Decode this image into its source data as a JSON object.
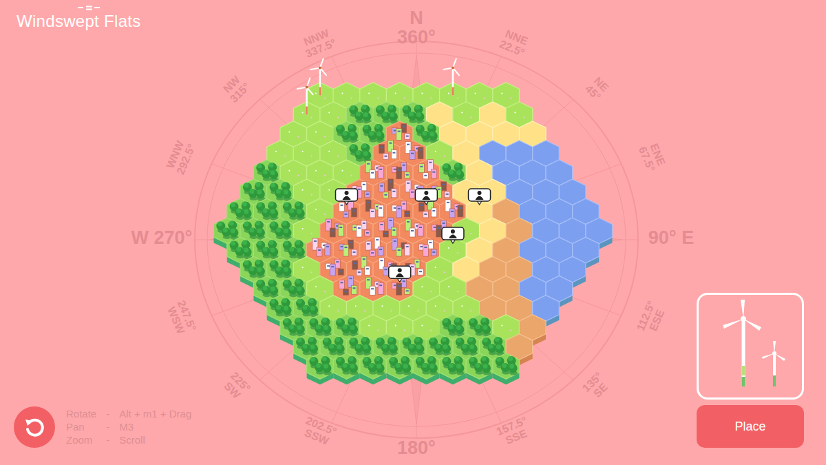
{
  "game": {
    "title": "Windswept Flats"
  },
  "compass": [
    {
      "lines": [
        "N",
        "360°"
      ]
    },
    {
      "lines": [
        "NNE",
        "22.5°"
      ]
    },
    {
      "lines": [
        "NE",
        "45°"
      ]
    },
    {
      "lines": [
        "ENE",
        "67.5°"
      ]
    },
    {
      "lines": [
        "90° E"
      ]
    },
    {
      "lines": [
        "ESE",
        "112.5°"
      ]
    },
    {
      "lines": [
        "SE",
        "135°"
      ]
    },
    {
      "lines": [
        "SSE",
        "157.5°"
      ]
    },
    {
      "lines": [
        "180°"
      ]
    },
    {
      "lines": [
        "SSW",
        "202.5°"
      ]
    },
    {
      "lines": [
        "SW",
        "225°"
      ]
    },
    {
      "lines": [
        "WSW",
        "247.5°"
      ]
    },
    {
      "lines": [
        "W 270°"
      ]
    },
    {
      "lines": [
        "WNW",
        "292.5°"
      ]
    },
    {
      "lines": [
        "NW",
        "315°"
      ]
    },
    {
      "lines": [
        "NNW",
        "337.5°"
      ]
    }
  ],
  "map": {
    "rows": [
      [
        "grass",
        "grass",
        "grass",
        "grass",
        "grass",
        "grass",
        "grass",
        "grass"
      ],
      [
        "grass",
        "grass",
        "forest",
        "forest",
        "forest",
        "sand",
        "grass",
        "sand",
        "grass"
      ],
      [
        "grass",
        "grass",
        "forest",
        "forest",
        "town",
        "forest",
        "sand",
        "sand",
        "sand",
        "sand"
      ],
      [
        "grass",
        "grass",
        "grass",
        "forest",
        "town",
        "town",
        "grass",
        "sand",
        "water",
        "water",
        "water"
      ],
      [
        "forest",
        "grass",
        "grass",
        "grass",
        "town",
        "town",
        "town",
        "forest",
        "sand",
        "water",
        "water",
        "water"
      ],
      [
        "forest",
        "forest",
        "grass",
        "grass",
        "town",
        "town",
        "town",
        "town",
        "sand",
        "sand",
        "water",
        "water",
        "water"
      ],
      [
        "forest",
        "forest",
        "forest",
        "grass",
        "town",
        "town",
        "town",
        "town",
        "town",
        "sand",
        "dirt",
        "water",
        "water",
        "water"
      ],
      [
        "forest",
        "forest",
        "forest",
        "grass",
        "town",
        "town",
        "town",
        "town",
        "town",
        "grass",
        "sand",
        "dirt",
        "water",
        "water",
        "water"
      ],
      [
        "forest",
        "forest",
        "forest",
        "town",
        "town",
        "town",
        "town",
        "town",
        "grass",
        "sand",
        "dirt",
        "water",
        "water",
        "water"
      ],
      [
        "forest",
        "forest",
        "grass",
        "town",
        "town",
        "town",
        "town",
        "grass",
        "sand",
        "dirt",
        "dirt",
        "water",
        "water"
      ],
      [
        "forest",
        "forest",
        "grass",
        "town",
        "town",
        "town",
        "grass",
        "grass",
        "dirt",
        "dirt",
        "water",
        "water"
      ],
      [
        "forest",
        "forest",
        "grass",
        "grass",
        "grass",
        "grass",
        "grass",
        "grass",
        "dirt",
        "dirt",
        "water"
      ],
      [
        "forest",
        "forest",
        "forest",
        "grass",
        "grass",
        "grass",
        "forest",
        "forest",
        "grass",
        "dirt"
      ],
      [
        "forest",
        "forest",
        "forest",
        "forest",
        "forest",
        "forest",
        "forest",
        "forest",
        "dirt"
      ],
      [
        "forest",
        "forest",
        "forest",
        "forest",
        "forest",
        "forest",
        "forest",
        "forest"
      ]
    ],
    "markers": [
      {
        "row": 6,
        "col": 4
      },
      {
        "row": 6,
        "col": 7
      },
      {
        "row": 6,
        "col": 9
      },
      {
        "row": 8,
        "col": 8
      },
      {
        "row": 10,
        "col": 5
      }
    ],
    "turbines": [
      {
        "row": 0,
        "col": 0
      },
      {
        "row": 1,
        "col": 0
      },
      {
        "row": 0,
        "col": 5
      }
    ]
  },
  "controls": [
    {
      "action": "Rotate",
      "sep": "-",
      "keys": "Alt + m1 + Drag"
    },
    {
      "action": "Pan",
      "sep": "-",
      "keys": "M3"
    },
    {
      "action": "Zoom",
      "sep": "-",
      "keys": "Scroll"
    }
  ],
  "place_button": "Place"
}
